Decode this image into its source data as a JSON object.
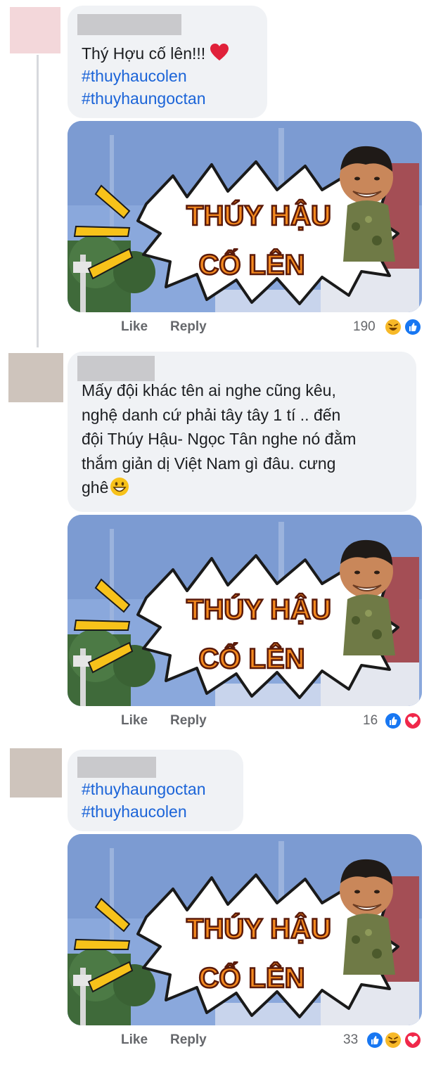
{
  "colors": {
    "hashtag": "#1b64d8",
    "bubble": "#f0f2f5",
    "meta_text": "#65676b",
    "like_blue": "#1877f2",
    "love_red": "#f0284a",
    "haha_yellow": "#f7b928"
  },
  "comments": [
    {
      "text": "Thý Hợu cố lên!!!",
      "emoji_icon": "red-heart",
      "hashtags": [
        "#thuyhaucolen",
        "#thuyhaungoctan"
      ],
      "image": {
        "line1": "THÚY HẬU",
        "line2": "CỐ LÊN"
      },
      "like_label": "Like",
      "reply_label": "Reply",
      "reaction_count": "190",
      "reactions": [
        "haha",
        "like"
      ]
    },
    {
      "text_lines": [
        "Mấy đội khác tên ai nghe cũng kêu,",
        "nghệ danh cứ phải tây tây 1 tí .. đến",
        "đội Thúy Hậu- Ngọc Tân nghe nó đằm",
        "thắm giản dị Việt Nam gì đâu. cưng",
        "ghê"
      ],
      "emoji_icon": "grinning-face",
      "image": {
        "line1": "THÚY HẬU",
        "line2": "CỐ LÊN"
      },
      "like_label": "Like",
      "reply_label": "Reply",
      "reaction_count": "16",
      "reactions": [
        "like",
        "love"
      ]
    },
    {
      "hashtags": [
        "#thuyhaungoctan",
        "#thuyhaucolen"
      ],
      "image": {
        "line1": "THÚY HẬU",
        "line2": "CỐ LÊN"
      },
      "like_label": "Like",
      "reply_label": "Reply",
      "reaction_count": "33",
      "reactions": [
        "like",
        "haha",
        "love"
      ]
    }
  ]
}
